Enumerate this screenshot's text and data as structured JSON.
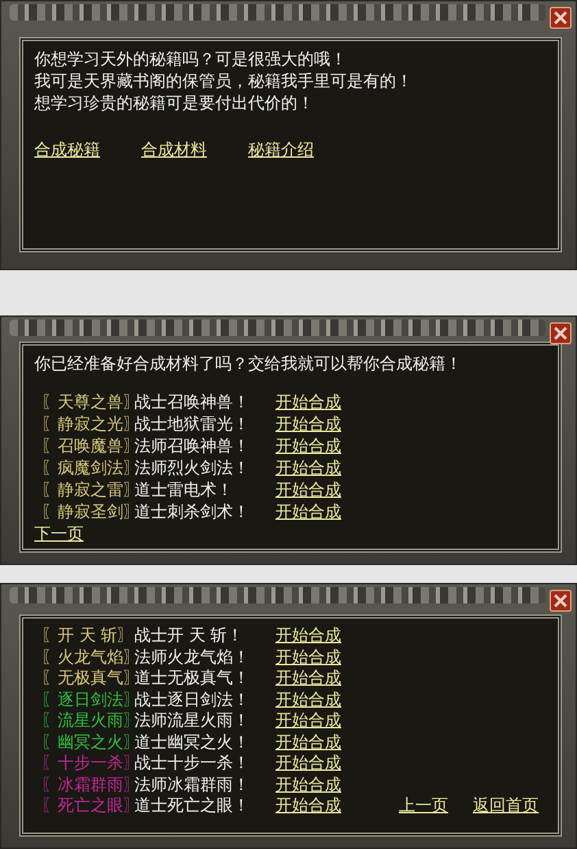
{
  "panels": [
    {
      "kind": "intro",
      "lines": [
        "你想学习天外的秘籍吗？可是很强大的哦！",
        "我可是天界藏书阁的保管员，秘籍我手里可是有的！",
        "想学习珍贵的秘籍可是要付出代价的！"
      ],
      "links": [
        "合成秘籍",
        "合成材料",
        "秘籍介绍"
      ]
    },
    {
      "kind": "list_below",
      "lines": [
        "你已经准备好合成材料了吗？交给我就可以帮你合成秘籍！"
      ],
      "items": [
        {
          "tag": "〖天尊之兽〗",
          "color": "#d8c878",
          "desc": "战士召唤神兽！",
          "action": "开始合成"
        },
        {
          "tag": "〖静寂之光〗",
          "color": "#d8c878",
          "desc": "战士地狱雷光！",
          "action": "开始合成"
        },
        {
          "tag": "〖召唤魔兽〗",
          "color": "#d8c878",
          "desc": "法师召唤神兽！",
          "action": "开始合成"
        },
        {
          "tag": "〖疯魔剑法〗",
          "color": "#d8c878",
          "desc": "法师烈火剑法！",
          "action": "开始合成"
        },
        {
          "tag": "〖静寂之雷〗",
          "color": "#d8c878",
          "desc": "道士雷电术！",
          "action": "开始合成"
        },
        {
          "tag": "〖静寂圣剑〗",
          "color": "#d8c878",
          "desc": "道士刺杀剑术！",
          "action": "开始合成"
        }
      ],
      "links": [
        "下一页"
      ]
    },
    {
      "kind": "list_inline",
      "items": [
        {
          "tag": "〖开 天 斩〗",
          "color": "#d8c878",
          "desc": "战士开 天 斩！",
          "action": "开始合成"
        },
        {
          "tag": "〖火龙气焰〗",
          "color": "#d8c878",
          "desc": "法师火龙气焰！",
          "action": "开始合成"
        },
        {
          "tag": "〖无极真气〗",
          "color": "#d8c878",
          "desc": "道士无极真气！",
          "action": "开始合成"
        },
        {
          "tag": "〖逐日剑法〗",
          "color": "#30c040",
          "desc": "战士逐日剑法！",
          "action": "开始合成"
        },
        {
          "tag": "〖流星火雨〗",
          "color": "#30c040",
          "desc": "法师流星火雨！",
          "action": "开始合成"
        },
        {
          "tag": "〖幽冥之火〗",
          "color": "#30c040",
          "desc": "道士幽冥之火！",
          "action": "开始合成"
        },
        {
          "tag": "〖十步一杀〗",
          "color": "#c02898",
          "desc": "战士十步一杀！",
          "action": "开始合成"
        },
        {
          "tag": "〖冰霜群雨〗",
          "color": "#c02898",
          "desc": "法师冰霜群雨！",
          "action": "开始合成"
        },
        {
          "tag": "〖死亡之眼〗",
          "color": "#c02898",
          "desc": "道士死亡之眼！",
          "action": "开始合成"
        }
      ],
      "links": [
        "上一页",
        "返回首页"
      ]
    }
  ]
}
